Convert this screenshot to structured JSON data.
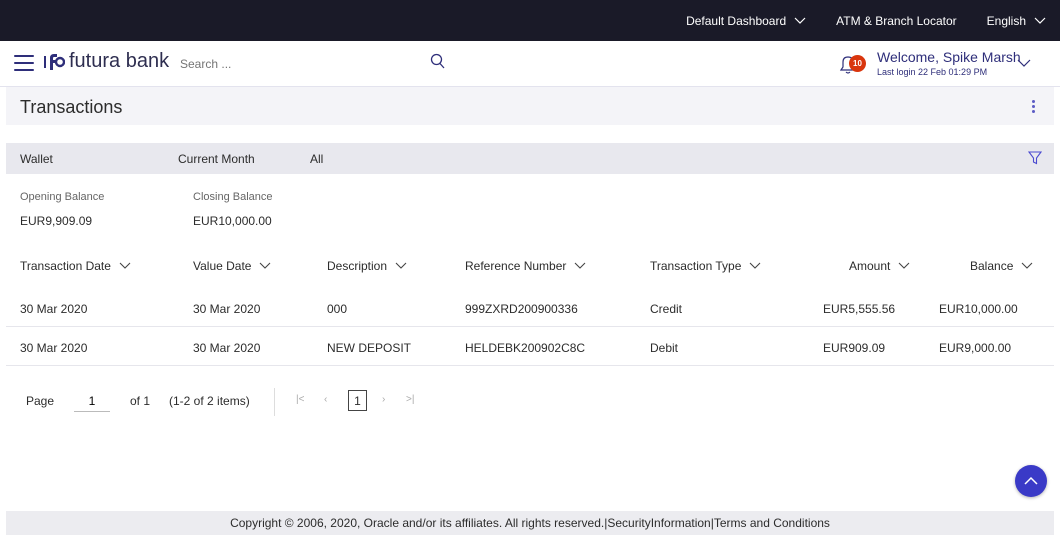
{
  "topbar": {
    "dashboard": "Default Dashboard",
    "locator": "ATM & Branch Locator",
    "language": "English"
  },
  "header": {
    "logo": "futura bank",
    "search_placeholder": "Search ...",
    "notification_count": "10",
    "welcome": "Welcome, Spike Marsh",
    "last_login": "Last login 22 Feb 01:29 PM"
  },
  "page": {
    "title": "Transactions"
  },
  "filters": {
    "account": "Wallet",
    "period": "Current Month",
    "type": "All"
  },
  "balances": {
    "opening_label": "Opening Balance",
    "opening_value": "EUR9,909.09",
    "closing_label": "Closing Balance",
    "closing_value": "EUR10,000.00"
  },
  "table": {
    "columns": [
      "Transaction Date",
      "Value Date",
      "Description",
      "Reference Number",
      "Transaction Type",
      "Amount",
      "Balance"
    ],
    "rows": [
      [
        "30 Mar 2020",
        "30 Mar 2020",
        "000",
        "999ZXRD200900336",
        "Credit",
        "EUR5,555.56",
        "EUR10,000.00"
      ],
      [
        "30 Mar 2020",
        "30 Mar 2020",
        "NEW DEPOSIT",
        "HELDEBK200902C8C",
        "Debit",
        "EUR909.09",
        "EUR9,000.00"
      ]
    ]
  },
  "pager": {
    "page_label": "Page",
    "page_value": "1",
    "of_label": "of 1",
    "items_label": "(1-2 of 2 items)",
    "current": "1"
  },
  "footer": {
    "copyright": "Copyright © 2006, 2020, Oracle and/or its affiliates. All rights reserved.",
    "security": "SecurityInformation",
    "terms": "Terms and Conditions"
  },
  "colors": {
    "topbar": "#1a1a28",
    "brand": "#2e2e7a",
    "accent": "#3a3ac7",
    "badge": "#d9360e"
  }
}
